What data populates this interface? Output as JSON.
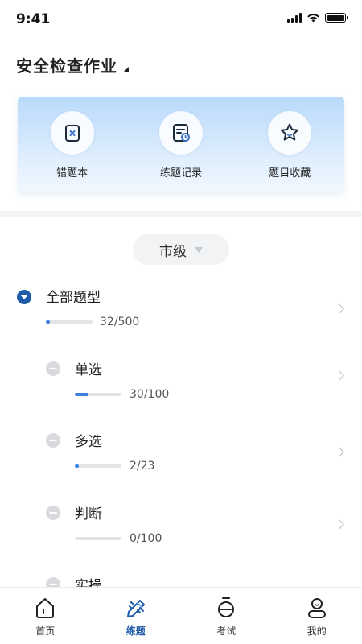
{
  "status_bar": {
    "time": "9:41"
  },
  "header": {
    "title": "安全检查作业"
  },
  "quick_actions": [
    {
      "label": "错题本",
      "icon": "wrong-book-icon"
    },
    {
      "label": "练题记录",
      "icon": "practice-record-icon"
    },
    {
      "label": "题目收藏",
      "icon": "star-icon"
    }
  ],
  "level_selector": {
    "value": "市级"
  },
  "tree": {
    "root": {
      "label": "全部题型",
      "done": 32,
      "total": 500,
      "progress_text": "32/500"
    },
    "children": [
      {
        "label": "单选",
        "done": 30,
        "total": 100,
        "progress_text": "30/100"
      },
      {
        "label": "多选",
        "done": 2,
        "total": 23,
        "progress_text": "2/23"
      },
      {
        "label": "判断",
        "done": 0,
        "total": 100,
        "progress_text": "0/100"
      },
      {
        "label": "实操"
      }
    ]
  },
  "tab_bar": [
    {
      "label": "首页",
      "icon": "home-icon",
      "active": false
    },
    {
      "label": "练题",
      "icon": "practice-icon",
      "active": true
    },
    {
      "label": "考试",
      "icon": "stopwatch-icon",
      "active": false
    },
    {
      "label": "我的",
      "icon": "profile-icon",
      "active": false
    }
  ],
  "colors": {
    "accent": "#1d5aa8",
    "progress": "#3b82e0"
  }
}
